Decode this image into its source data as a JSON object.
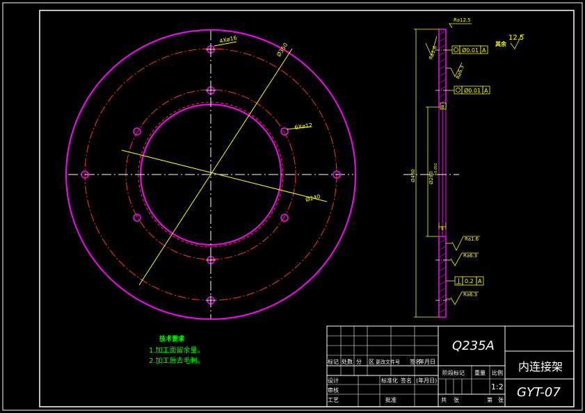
{
  "drawing": {
    "title": "内连接架",
    "drawing_no": "GYT-07",
    "material": "Q235A",
    "scale": "1:2"
  },
  "tech_requirements": {
    "heading": "技术要求",
    "items": [
      "1.加工面留余量。",
      "2.加工后去毛刺。"
    ]
  },
  "front_view": {
    "dim_outer": "Ø430",
    "dim_hole_pcd": "Ø350",
    "dim_holes_outer": "4Xø16",
    "dim_holes_inner": "6Xø12",
    "dim_inner": "Ø240"
  },
  "section_view": {
    "roughness_top": "Ra12.5",
    "roughness_1": "Ra1.6",
    "roughness_2": "Ra6.3",
    "roughness_3": "Ra1.6",
    "roughness_4": "Ra6.3",
    "roughness_5": "Ra6.3",
    "other_roughness_label": "其余",
    "other_roughness_value": "12.5",
    "tol_1": [
      "Ø0.01",
      "A"
    ],
    "tol_2": [
      "Ø0.01",
      "A"
    ],
    "tol_3": [
      "0.2",
      "A"
    ],
    "datum": "B",
    "dim_overall": "Ø430",
    "dim_fit": "Ø280",
    "dim_fit_tol": "+0.052",
    "dim_thickness": "9"
  },
  "title_block": {
    "row_labels": [
      "标记",
      "处数",
      "分",
      "区",
      "更改文件号",
      "签名",
      "年月日"
    ],
    "designed": "设计",
    "checked": "审核",
    "process": "工艺",
    "standardized": "标准化",
    "signature": "签名",
    "date": "(年月日)",
    "approved": "批准",
    "stage_mark": "阶段标记",
    "weight": "重量",
    "scale_label": "比例",
    "total": "共",
    "sheets": "张",
    "sheet_no": "第",
    "sheet": "张"
  }
}
